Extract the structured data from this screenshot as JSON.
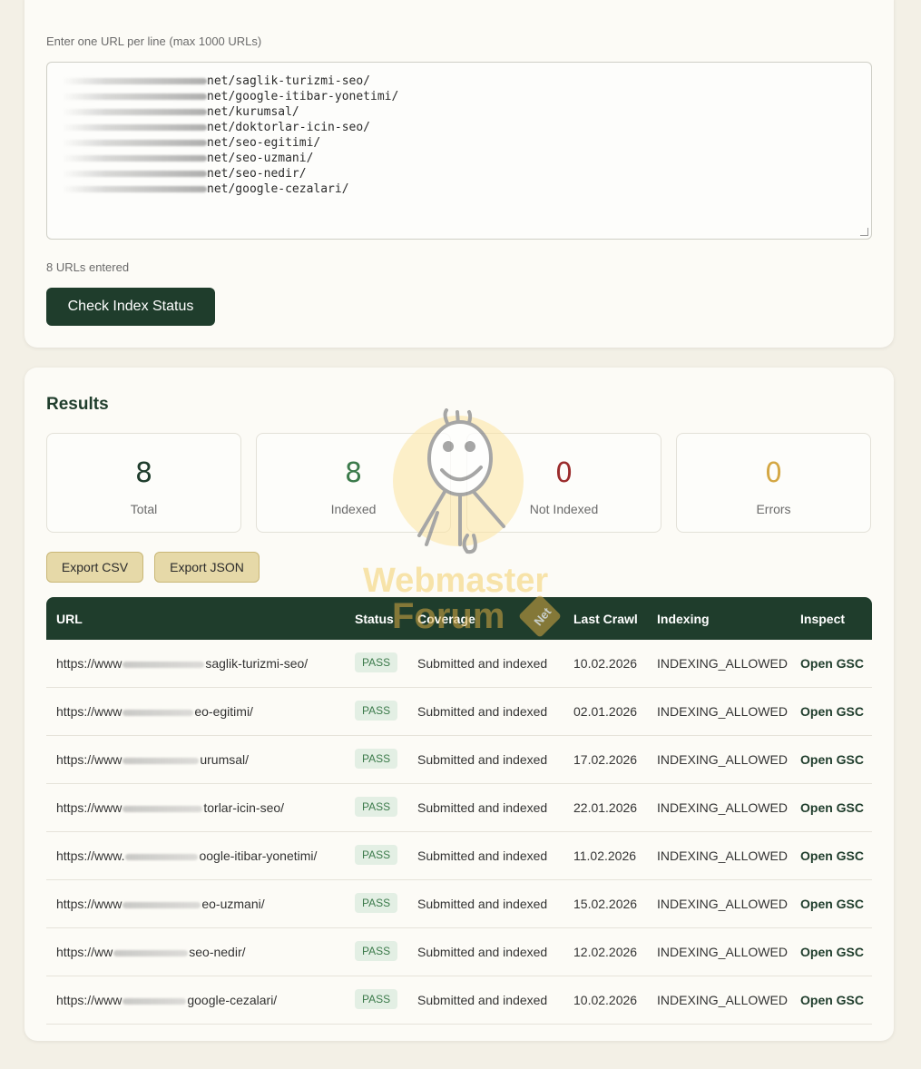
{
  "input": {
    "label": "Enter one URL per line (max 1000 URLs)",
    "lines": [
      "net/saglik-turizmi-seo/",
      "net/google-itibar-yonetimi/",
      "net/kurumsal/",
      "net/doktorlar-icin-seo/",
      "net/seo-egitimi/",
      "net/seo-uzmani/",
      "net/seo-nedir/",
      "net/google-cezalari/"
    ],
    "count_text": "8 URLs entered",
    "submit_label": "Check Index Status"
  },
  "results": {
    "title": "Results",
    "stats": [
      {
        "value": "8",
        "label": "Total",
        "color": "#1f3d2c"
      },
      {
        "value": "8",
        "label": "Indexed",
        "color": "#3b7a4a"
      },
      {
        "value": "0",
        "label": "Not Indexed",
        "color": "#9b2d2d"
      },
      {
        "value": "0",
        "label": "Errors",
        "color": "#d4a743"
      }
    ],
    "export_csv": "Export CSV",
    "export_json": "Export JSON",
    "columns": [
      "URL",
      "Status",
      "Coverage",
      "Last Crawl",
      "Indexing",
      "Inspect"
    ],
    "rows": [
      {
        "url_start": "https://www",
        "url_end": "saglik-turizmi-seo/",
        "status": "PASS",
        "coverage": "Submitted and indexed",
        "crawl": "10.02.2026",
        "indexing": "INDEXING_ALLOWED",
        "inspect": "Open GSC"
      },
      {
        "url_start": "https://www",
        "url_end": "eo-egitimi/",
        "status": "PASS",
        "coverage": "Submitted and indexed",
        "crawl": "02.01.2026",
        "indexing": "INDEXING_ALLOWED",
        "inspect": "Open GSC"
      },
      {
        "url_start": "https://www",
        "url_end": "urumsal/",
        "status": "PASS",
        "coverage": "Submitted and indexed",
        "crawl": "17.02.2026",
        "indexing": "INDEXING_ALLOWED",
        "inspect": "Open GSC"
      },
      {
        "url_start": "https://www",
        "url_end": "torlar-icin-seo/",
        "status": "PASS",
        "coverage": "Submitted and indexed",
        "crawl": "22.01.2026",
        "indexing": "INDEXING_ALLOWED",
        "inspect": "Open GSC"
      },
      {
        "url_start": "https://www.",
        "url_end": "oogle-itibar-yonetimi/",
        "status": "PASS",
        "coverage": "Submitted and indexed",
        "crawl": "11.02.2026",
        "indexing": "INDEXING_ALLOWED",
        "inspect": "Open GSC"
      },
      {
        "url_start": "https://www",
        "url_end": "eo-uzmani/",
        "status": "PASS",
        "coverage": "Submitted and indexed",
        "crawl": "15.02.2026",
        "indexing": "INDEXING_ALLOWED",
        "inspect": "Open GSC"
      },
      {
        "url_start": "https://ww",
        "url_end": "seo-nedir/",
        "status": "PASS",
        "coverage": "Submitted and indexed",
        "crawl": "12.02.2026",
        "indexing": "INDEXING_ALLOWED",
        "inspect": "Open GSC"
      },
      {
        "url_start": "https://www",
        "url_end": "google-cezalari/",
        "status": "PASS",
        "coverage": "Submitted and indexed",
        "crawl": "10.02.2026",
        "indexing": "INDEXING_ALLOWED",
        "inspect": "Open GSC"
      }
    ]
  },
  "watermark": {
    "text_line1": "Webmaster",
    "text_line2": "Forum",
    "text_badge": "Net"
  }
}
